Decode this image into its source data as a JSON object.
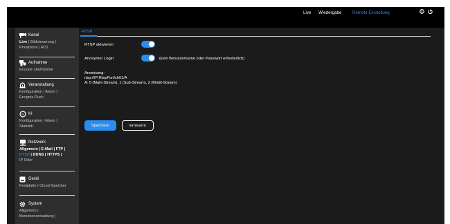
{
  "header": {
    "nav": [
      {
        "label": "Live"
      },
      {
        "label": "Wiedergabe"
      },
      {
        "label": "Remote Einstellung",
        "active": true
      }
    ],
    "icons": [
      "info-icon",
      "power-icon"
    ]
  },
  "sidebar": {
    "groups": [
      {
        "title": "Kanal",
        "icon": "camera-icon",
        "links": [
          "Live",
          "Bildsteuerung",
          "Privatzone",
          "ROI"
        ]
      },
      {
        "title": "Aufnahme",
        "icon": "record-icon",
        "links": [
          "Encode",
          "Aufnahme"
        ]
      },
      {
        "title": "Veranstaltung",
        "icon": "alarm-icon",
        "links": [
          "Konfiguration",
          "Alarm",
          "Ereignis-Push"
        ]
      },
      {
        "title": "KI",
        "icon": "ai-icon",
        "links": [
          "Konfiguration",
          "Alarm",
          "Statistik"
        ]
      },
      {
        "title": "Netzwerk",
        "icon": "network-icon",
        "links": [
          "Allgemein",
          "E-Mail",
          "FTP",
          "RTSP",
          "DDNS",
          "HTTPS",
          "IP Filter"
        ],
        "selected": "RTSP"
      },
      {
        "title": "Gerät",
        "icon": "disk-icon",
        "links": [
          "Festplatte",
          "Cloud-Speicher"
        ]
      },
      {
        "title": "System",
        "icon": "system-gear-icon",
        "links": [
          "Allgemein",
          "Benutzerverwaltung"
        ]
      }
    ]
  },
  "content": {
    "tab": "RTSP",
    "rtsp_enable_label": "RTSP aktivieren",
    "rtsp_enabled": true,
    "anonymous_login_label": "Anonymer Login",
    "anonymous_login_enabled": true,
    "anonymous_hint": "(kein Benutzername oder Passwort erforderlich)",
    "instruction_title": "Anweisung:",
    "instruction_url": "rtsp://IP:RtspPort/ch01/A",
    "instruction_streams": "A: 0 (Main-Stream), 1 (Sub-Stream), 2 (Mobil-Stream)",
    "save_label": "Speichern",
    "refresh_label": "Erneuern"
  },
  "colors": {
    "accent": "#2d8cf0",
    "background": "#1b1b1b",
    "sidebar": "#2e2e2e",
    "topbar": "#000000"
  }
}
